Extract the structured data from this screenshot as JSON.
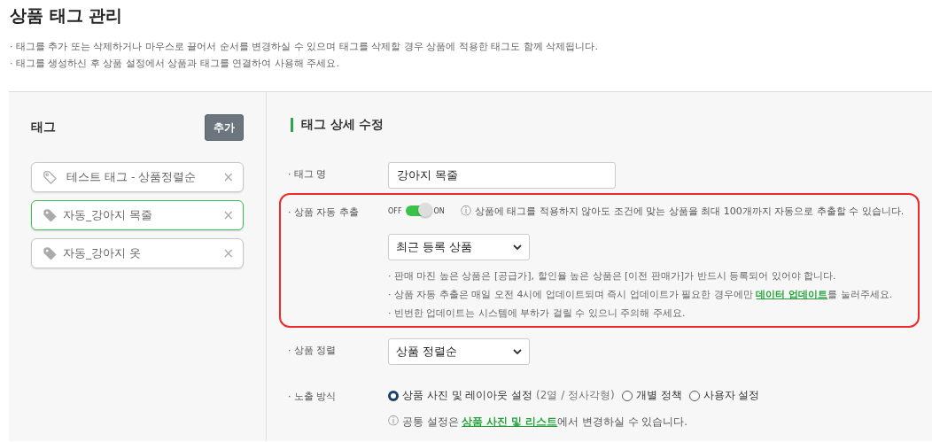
{
  "page_title": "상품 태그 관리",
  "notices": [
    "· 태그를 추가 또는 삭제하거나 마우스로 끌어서 순서를 변경하실 수 있으며 태그를 삭제할 경우 상품에 적용한 태그도 함께 삭제됩니다.",
    "· 태그를 생성하신 후 상품 설정에서 상품과 태그를 연결하여 사용해 주세요."
  ],
  "tag_panel": {
    "title": "태그",
    "add_button": "추가",
    "remove_symbol": "×",
    "tags": [
      {
        "label": "테스트 태그 - 상품정렬순",
        "kind": "manual",
        "selected": false
      },
      {
        "label": "자동_강아지 목줄",
        "kind": "auto",
        "selected": true
      },
      {
        "label": "자동_강아지 옷",
        "kind": "auto",
        "selected": false
      }
    ]
  },
  "detail": {
    "title": "태그 상세 수정",
    "tag_name": {
      "label": "· 태그 명",
      "value": "강아지 목줄"
    },
    "auto_extract": {
      "label": "· 상품 자동 추출",
      "off_label": "OFF",
      "on_label": "ON",
      "on": true,
      "info_icon": "ⓘ",
      "info": "상품에 태그를 적용하지 않아도 조건에 맞는 상품을 최대 100개까지 자동으로 추출할 수 있습니다.",
      "select": "최근 등록 상품",
      "notes": [
        {
          "before": "· 판매 마진 높은 상품은 [공급가], 할인율 높은 상품은 [이전 판매가]가 반드시 등록되어 있어야 합니다."
        },
        {
          "before": "· 상품 자동 추출은 매일 오전 4시에 업데이트되며 즉시 업데이트가 필요한 경우에만 ",
          "link": "데이터 업데이트",
          "after": "를 눌러주세요."
        },
        {
          "before": "· 빈번한 업데이트는 시스템에 부하가 걸릴 수 있으니 주의해 주세요."
        }
      ]
    },
    "sort": {
      "label": "· 상품 정렬",
      "select": "상품 정렬순"
    },
    "display": {
      "label": "· 노출 방식",
      "options": [
        {
          "label": "상품 사진 및 레이아웃 설정",
          "note": "(2열 / 정사각형)",
          "selected": true
        },
        {
          "label": "개별 정책",
          "selected": false
        },
        {
          "label": "사용자 설정",
          "selected": false
        }
      ],
      "info_icon": "ⓘ",
      "info": {
        "before": "공통 설정은 ",
        "link": "상품 사진 및 리스트",
        "after": "에서 변경하실 수 있습니다."
      }
    }
  }
}
